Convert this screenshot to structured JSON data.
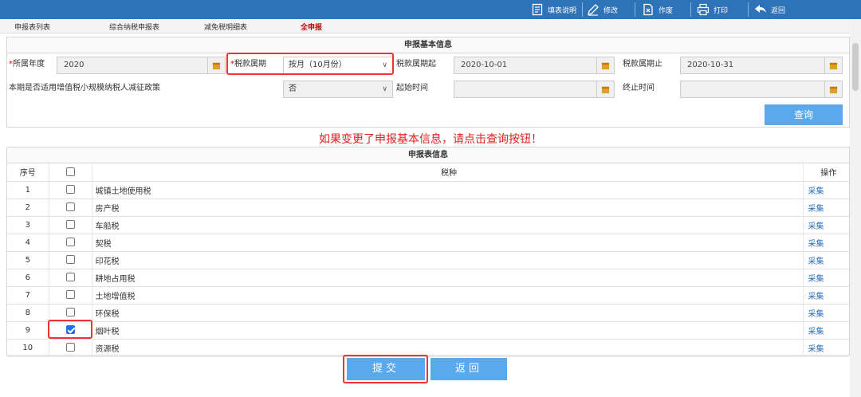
{
  "toolbar": {
    "fill_help": "填表说明",
    "edit": "修改",
    "void": "作废",
    "print": "打印",
    "back": "返回"
  },
  "tabs": [
    "申报表列表",
    "综合纳税申报表",
    "减免税明细表",
    "全申报"
  ],
  "basic": {
    "title": "申报基本信息",
    "year_label": "所属年度",
    "year_value": "2020",
    "period_label": "税款属期",
    "period_value": "按月（10月份）",
    "start_label": "税款属期起",
    "start_value": "2020-10-01",
    "end_label": "税款属期止",
    "end_value": "2020-10-31",
    "policy_label": "本期是否适用增值税小规模纳税人减征政策",
    "policy_value": "否",
    "from_label": "起始时间",
    "from_value": "",
    "to_label": "终止时间",
    "to_value": "",
    "query": "查询"
  },
  "notice": "如果变更了申报基本信息，请点击查询按钮！",
  "table": {
    "title": "申报表信息",
    "headers": [
      "序号",
      "",
      "税种",
      "操作"
    ],
    "rows": [
      {
        "no": "1",
        "name": "城镇土地使用税",
        "op": "采集",
        "checked": false
      },
      {
        "no": "2",
        "name": "房产税",
        "op": "采集",
        "checked": false
      },
      {
        "no": "3",
        "name": "车船税",
        "op": "采集",
        "checked": false
      },
      {
        "no": "4",
        "name": "契税",
        "op": "采集",
        "checked": false
      },
      {
        "no": "5",
        "name": "印花税",
        "op": "采集",
        "checked": false
      },
      {
        "no": "6",
        "name": "耕地占用税",
        "op": "采集",
        "checked": false
      },
      {
        "no": "7",
        "name": "土地增值税",
        "op": "采集",
        "checked": false
      },
      {
        "no": "8",
        "name": "环保税",
        "op": "采集",
        "checked": false
      },
      {
        "no": "9",
        "name": "烟叶税",
        "op": "采集",
        "checked": true
      },
      {
        "no": "10",
        "name": "资源税",
        "op": "采集",
        "checked": false
      }
    ]
  },
  "actions": {
    "submit": "提交",
    "return": "返回"
  },
  "colors": {
    "toolbar_bg": "#2e72b8",
    "button_bg": "#5aa9ec",
    "highlight": "#e33333",
    "notice": "#e02020"
  }
}
